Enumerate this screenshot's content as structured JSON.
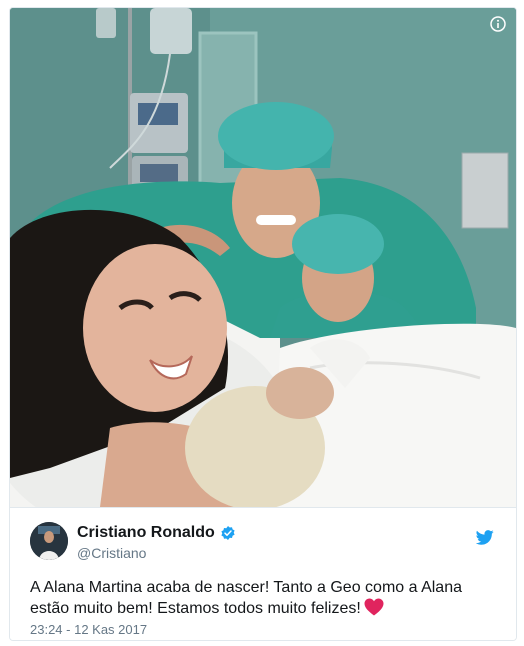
{
  "tweet": {
    "photo_alt": "Hospital selfie photo",
    "author": {
      "name": "Cristiano Ronaldo",
      "handle": "@Cristiano"
    },
    "text": "A Alana Martina acaba de nascer! Tanto a Geo como a Alana estão muito bem! Estamos todos muito felizes!",
    "emoji": "heart-emoji",
    "timestamp": "23:24 - 12 Kas 2017",
    "icons": [
      "info-icon",
      "verified-badge-icon",
      "twitter-bird-icon",
      "heart-icon"
    ],
    "colors": {
      "accent": "#1da1f2",
      "text": "#14171a",
      "muted": "#657786",
      "heart": "#e0245e",
      "border": "#e1e8ed"
    }
  }
}
